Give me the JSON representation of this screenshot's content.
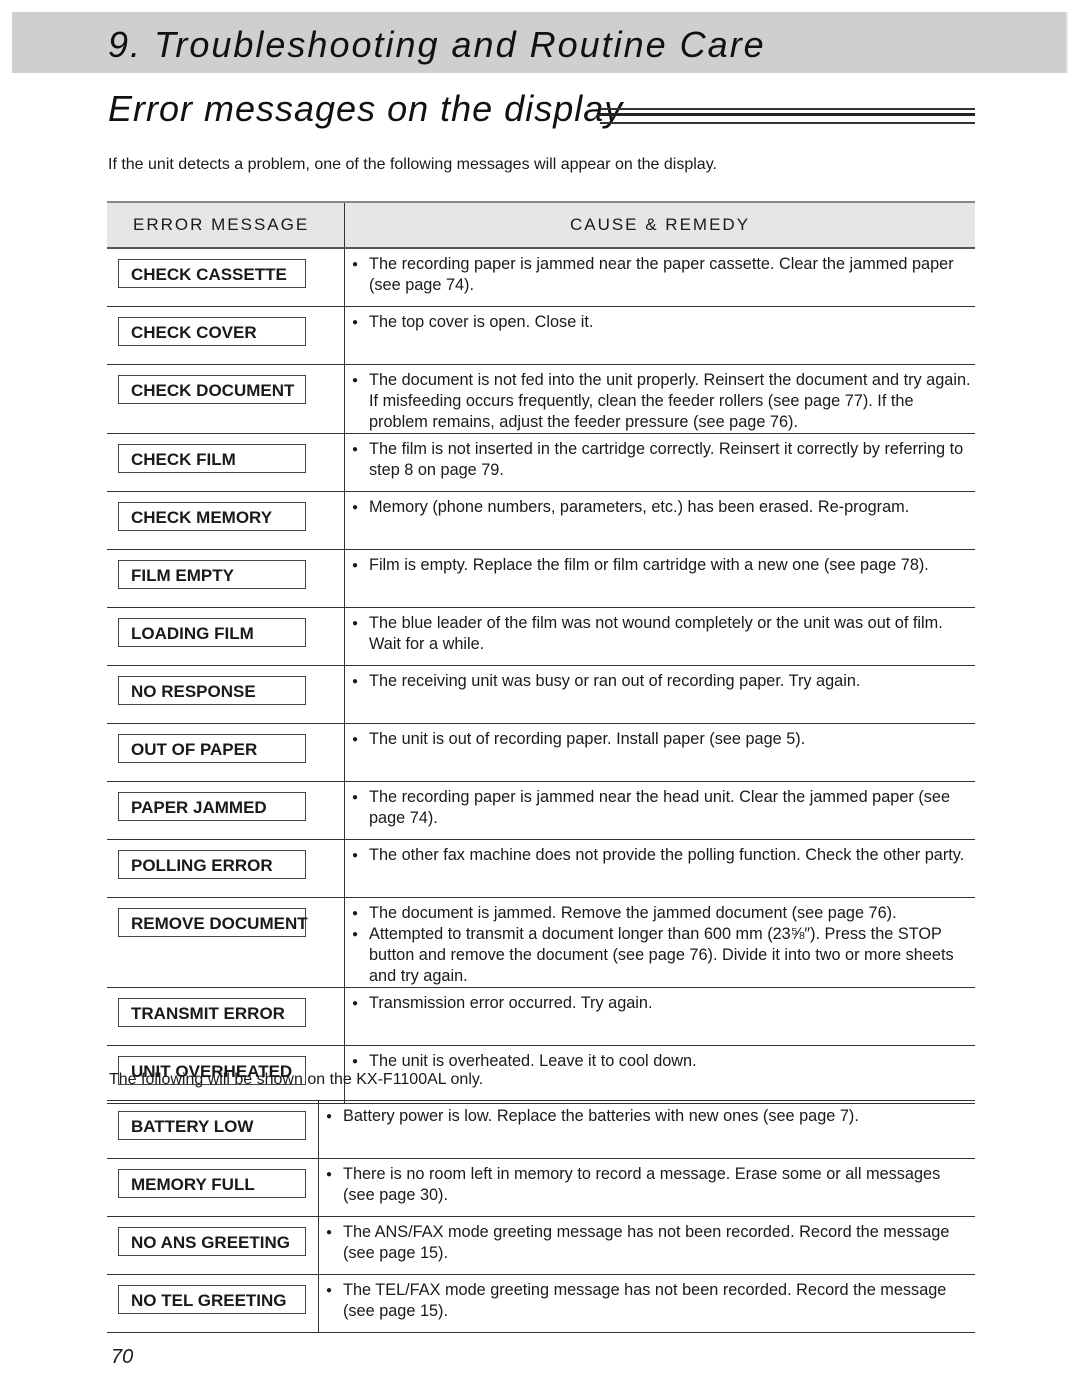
{
  "chapter_title": "9. Troubleshooting and Routine Care",
  "section_title": "Error messages on the display",
  "intro": "If the unit detects a problem, one of the following messages will appear on the display.",
  "table_headers": {
    "message": "ERROR MESSAGE",
    "cause": "CAUSE & REMEDY"
  },
  "rows": [
    {
      "message": "CHECK CASSETTE",
      "causes": [
        "The recording paper is jammed near the paper cassette. Clear the jammed paper (see page 74)."
      ]
    },
    {
      "message": "CHECK COVER",
      "causes": [
        "The top cover is open. Close it."
      ]
    },
    {
      "message": "CHECK DOCUMENT",
      "causes": [
        "The document is not fed into the unit properly. Reinsert the document and try again. If misfeeding occurs frequently, clean the feeder rollers (see page 77). If the problem remains, adjust the feeder pressure (see page 76)."
      ]
    },
    {
      "message": "CHECK FILM",
      "causes": [
        "The film is not inserted in the cartridge correctly. Reinsert it correctly by referring to step 8 on page 79."
      ]
    },
    {
      "message": "CHECK MEMORY",
      "causes": [
        "Memory (phone numbers, parameters, etc.) has been erased. Re-program."
      ]
    },
    {
      "message": "FILM EMPTY",
      "causes": [
        "Film is empty. Replace the film or film cartridge with a new one (see page 78)."
      ]
    },
    {
      "message": "LOADING FILM",
      "causes": [
        "The blue leader of the film was not wound completely or the unit was out of film. Wait for a while."
      ]
    },
    {
      "message": "NO RESPONSE",
      "causes": [
        "The receiving unit was busy or ran out of recording paper. Try again."
      ]
    },
    {
      "message": "OUT OF PAPER",
      "causes": [
        "The unit is out of recording paper. Install paper (see page 5)."
      ]
    },
    {
      "message": "PAPER JAMMED",
      "causes": [
        "The recording paper is jammed near the head unit. Clear the jammed paper (see page 74)."
      ]
    },
    {
      "message": "POLLING ERROR",
      "causes": [
        "The other fax machine does not provide the polling function. Check the other party."
      ]
    },
    {
      "message": "REMOVE DOCUMENT",
      "causes": [
        "The document is jammed. Remove the jammed document (see page 76).",
        "Attempted to transmit a document longer than 600 mm (23⅝″). Press the STOP button and remove the document (see page 76). Divide it into two or more sheets and try again."
      ]
    },
    {
      "message": "TRANSMIT ERROR",
      "causes": [
        "Transmission error occurred. Try again."
      ]
    },
    {
      "message": "UNIT OVERHEATED",
      "causes": [
        "The unit is overheated. Leave it to cool down."
      ]
    }
  ],
  "note": "The following will be shown on the KX-F1100AL only.",
  "rows2": [
    {
      "message": "BATTERY LOW",
      "causes": [
        "Battery power is low. Replace the batteries with new ones (see page 7)."
      ]
    },
    {
      "message": "MEMORY FULL",
      "causes": [
        "There is no room left in memory to record a message. Erase some or all messages (see page 30)."
      ]
    },
    {
      "message": "NO ANS GREETING",
      "causes": [
        "The ANS/FAX mode greeting message has not been recorded. Record the message (see page 15)."
      ]
    },
    {
      "message": "NO TEL GREETING",
      "causes": [
        "The TEL/FAX mode greeting message has not been recorded. Record the message (see page 15)."
      ]
    }
  ],
  "page_number": "70"
}
